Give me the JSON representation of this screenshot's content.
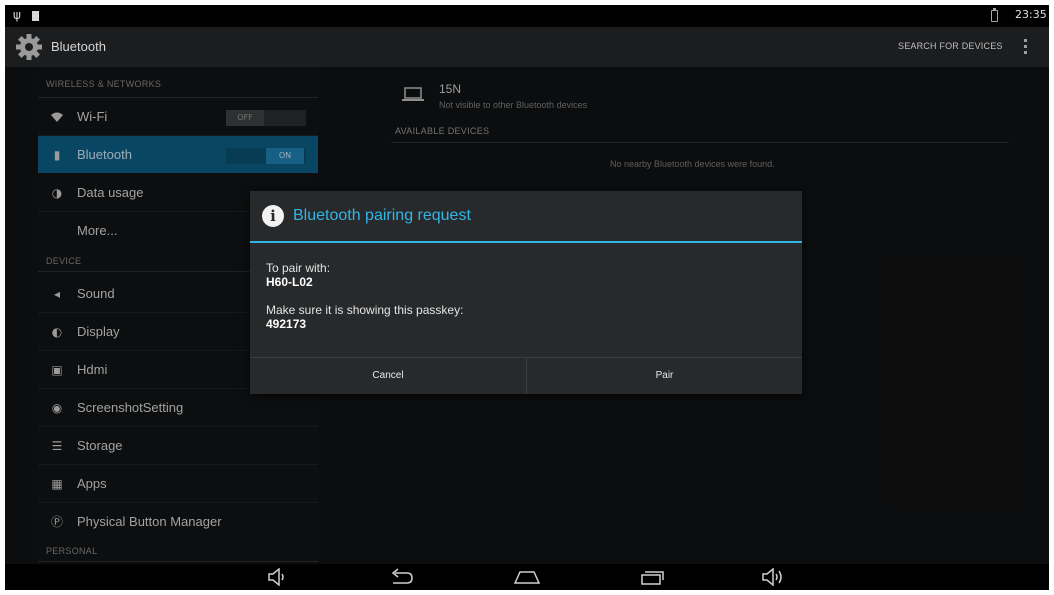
{
  "status_bar": {
    "time": "23:35"
  },
  "action_bar": {
    "title": "Bluetooth",
    "search_label": "SEARCH FOR DEVICES"
  },
  "settings": {
    "section_wireless": "WIRELESS & NETWORKS",
    "section_device": "DEVICE",
    "section_personal": "PERSONAL",
    "items": [
      {
        "label": "Wi-Fi",
        "icon": "wifi-icon",
        "toggle": "OFF"
      },
      {
        "label": "Bluetooth",
        "icon": "bluetooth-icon",
        "toggle": "ON",
        "selected": true
      },
      {
        "label": "Data usage",
        "icon": "data-usage-icon"
      },
      {
        "label": "More..."
      },
      {
        "label": "Sound",
        "icon": "sound-icon"
      },
      {
        "label": "Display",
        "icon": "display-icon"
      },
      {
        "label": "Hdmi",
        "icon": "hdmi-icon"
      },
      {
        "label": "ScreenshotSetting",
        "icon": "screenshot-icon"
      },
      {
        "label": "Storage",
        "icon": "storage-icon"
      },
      {
        "label": "Apps",
        "icon": "apps-icon"
      },
      {
        "label": "Physical Button Manager",
        "icon": "physical-button-icon"
      }
    ]
  },
  "bluetooth_panel": {
    "device_name": "15N",
    "device_status": "Not visible to other Bluetooth devices",
    "available_header": "AVAILABLE DEVICES",
    "no_devices": "No nearby Bluetooth devices were found."
  },
  "dialog": {
    "title": "Bluetooth pairing request",
    "pair_with_label": "To pair with:",
    "device": "H60-L02",
    "passkey_label": "Make sure it is showing this passkey:",
    "passkey": "492173",
    "cancel_label": "Cancel",
    "pair_label": "Pair"
  },
  "nav_bar": {
    "buttons": [
      "volume-down-icon",
      "back-icon",
      "home-icon",
      "recents-icon",
      "volume-up-icon"
    ]
  },
  "colors": {
    "accent": "#33b5e5",
    "selected_item": "#0d5e86",
    "background": "#111213"
  }
}
